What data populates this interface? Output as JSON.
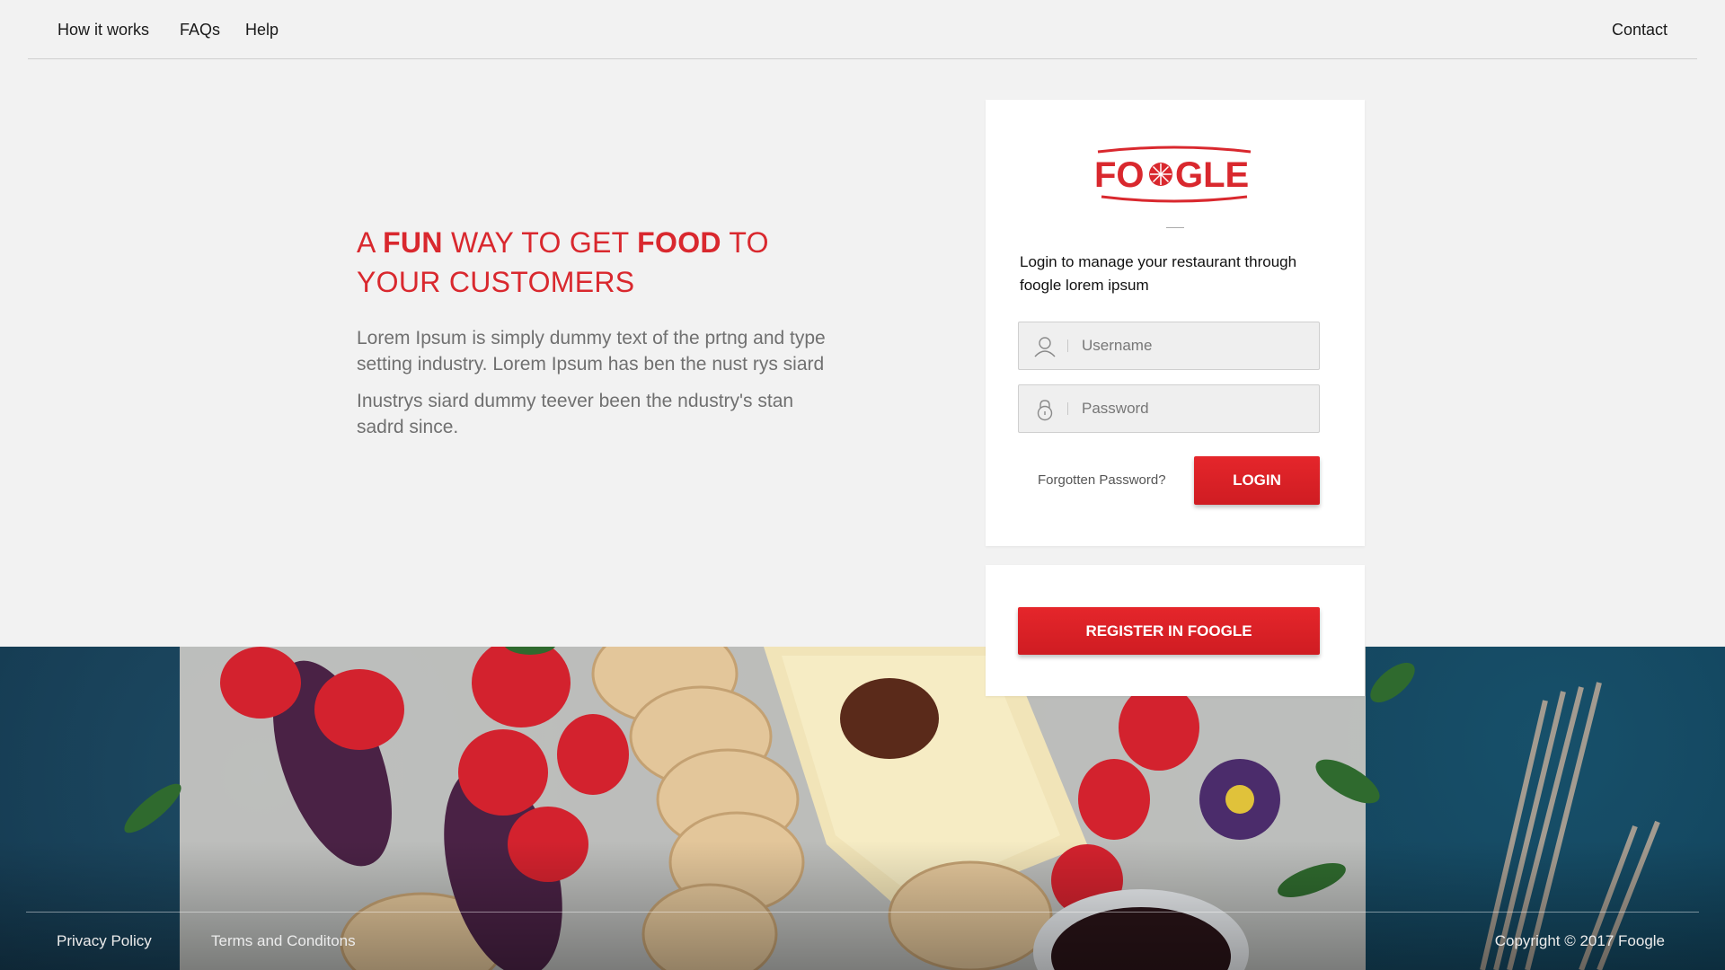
{
  "nav": {
    "links": [
      "How it works",
      "FAQs",
      "Help"
    ],
    "contact": "Contact"
  },
  "hero": {
    "headline": {
      "part1": "A ",
      "fun": "FUN",
      "part2": " WAY TO GET ",
      "food": "FOOD",
      "part3": " TO YOUR CUSTOMERS"
    },
    "paragraph1": "Lorem Ipsum is simply dummy text of the prtng and type setting industry. Lorem Ipsum has ben the nust rys siard",
    "paragraph2": "Inustrys siard dummy teever been the ndustry's stan sadrd since."
  },
  "login": {
    "logo_text": "FOOGLE",
    "intro": "Login to manage your restaurant through foogle lorem ipsum",
    "username_placeholder": "Username",
    "password_placeholder": "Password",
    "forgot_label": "Forgotten Password?",
    "login_label": "LOGIN"
  },
  "register": {
    "label": "REGISTER IN FOOGLE"
  },
  "footer": {
    "privacy": "Privacy Policy",
    "terms": "Terms and Conditons",
    "copyright": "Copyright © 2017 Foogle"
  },
  "colors": {
    "accent": "#d9282e",
    "button": "#dd2127"
  },
  "icons": [
    "user-icon",
    "lock-icon"
  ]
}
